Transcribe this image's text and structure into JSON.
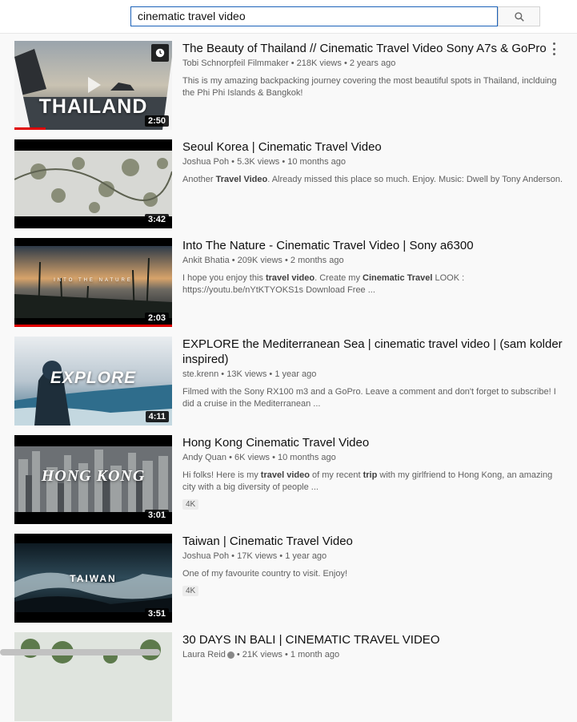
{
  "search": {
    "query": "cinematic travel video",
    "button_icon": "search-icon"
  },
  "results": [
    {
      "title": "The Beauty of Thailand // Cinematic Travel Video Sony A7s & GoPro",
      "channel": "Tobi Schnorpfeil Filmmaker",
      "views": "218K views",
      "age": "2 years ago",
      "description": "This is my amazing backpacking journey covering the most beautiful spots in Thailand, inclduing the Phi Phi Islands & Bangkok!",
      "duration": "2:50",
      "thumb_text": "THAILAND",
      "watched_fraction": 0.2
    },
    {
      "title": "Seoul Korea | Cinematic Travel Video",
      "channel": "Joshua Poh",
      "views": "5.3K views",
      "age": "10 months ago",
      "description_parts": [
        "Another ",
        "Travel Video",
        ". Already missed this place so much. Enjoy. Music: Dwell by Tony Anderson."
      ],
      "duration": "3:42"
    },
    {
      "title": "Into The Nature - Cinematic Travel Video | Sony a6300",
      "channel": "Ankit Bhatia",
      "views": "209K views",
      "age": "2 months ago",
      "description_parts": [
        "I hope you enjoy this ",
        "travel video",
        ". Create my ",
        "Cinematic Travel",
        " LOOK : https://youtu.be/nYtKTYOKS1s Download Free ..."
      ],
      "duration": "2:03",
      "thumb_text": "INTO THE NATURE",
      "watched_fraction": 1.0
    },
    {
      "title": "EXPLORE the Mediterranean Sea | cinematic travel video | (sam kolder inspired)",
      "channel": "ste.krenn",
      "views": "13K views",
      "age": "1 year ago",
      "description": "Filmed with the Sony RX100 m3 and a GoPro. Leave a comment and don't forget to subscribe! I did a cruise in the Mediterranean ...",
      "duration": "4:11",
      "thumb_text": "EXPLORE"
    },
    {
      "title": "Hong Kong Cinematic Travel Video",
      "channel": "Andy Quan",
      "views": "6K views",
      "age": "10 months ago",
      "description_parts": [
        "Hi folks! Here is my ",
        "travel video",
        " of my recent ",
        "trip",
        " with my girlfriend to Hong Kong, an amazing city with a big diversity of people ..."
      ],
      "badge": "4K",
      "duration": "3:01",
      "thumb_text": "HONG KONG"
    },
    {
      "title": "Taiwan | Cinematic Travel Video",
      "channel": "Joshua Poh",
      "views": "17K views",
      "age": "1 year ago",
      "description": "One of my favourite country to visit. Enjoy!",
      "badge": "4K",
      "duration": "3:51",
      "thumb_text": "TAIWAN"
    },
    {
      "title": "30 DAYS IN BALI | CINEMATIC TRAVEL VIDEO",
      "channel": "Laura Reid",
      "views": "21K views",
      "age": "1 month ago"
    }
  ],
  "colors": {
    "accent_blue": "#1c62b9",
    "progress_red": "#e00000",
    "text_secondary": "#606060"
  }
}
